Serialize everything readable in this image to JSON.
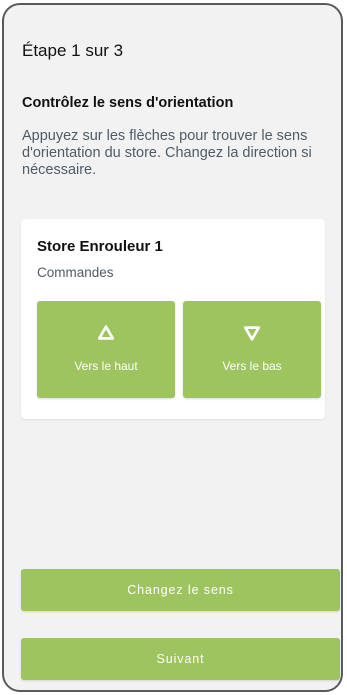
{
  "header": {
    "step_title": "Étape 1 sur 3"
  },
  "content": {
    "heading": "Contrôlez le sens d'orientation",
    "instructions": "Appuyez sur les flèches pour trouver le sens d'orientation du store. Changez la direction si nécessaire."
  },
  "device_card": {
    "name": "Store Enrouleur 1",
    "subtitle": "Commandes",
    "up_button": {
      "label": "Vers le haut",
      "icon": "triangle-up-icon"
    },
    "down_button": {
      "label": "Vers le bas",
      "icon": "triangle-down-icon"
    }
  },
  "actions": {
    "change_direction": "Changez le sens",
    "next": "Suivant"
  },
  "colors": {
    "accent_green": "#9dc45f",
    "background": "#f2f2f2",
    "card": "#ffffff",
    "muted_text": "#4f5b66"
  }
}
